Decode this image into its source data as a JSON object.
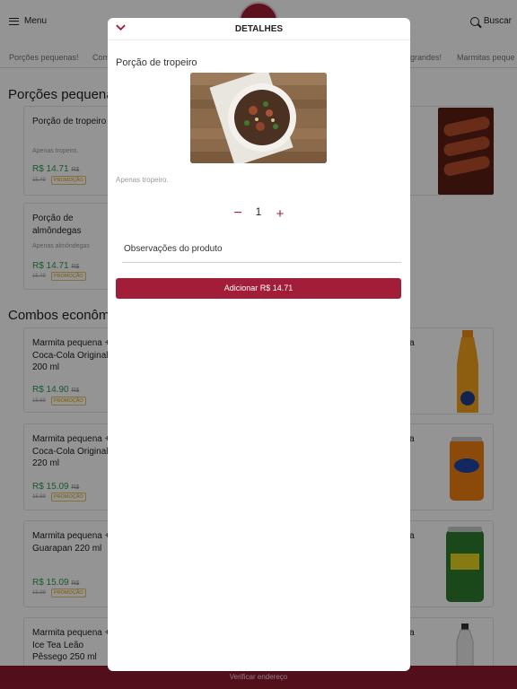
{
  "header": {
    "menu_label": "Menu",
    "search_label": "Buscar",
    "icons": [
      "menu-icon",
      "search-icon",
      "logo"
    ]
  },
  "categories": [
    "Porções pequenas!",
    "Com",
    "grandes!",
    "Marmitas peque"
  ],
  "sections": {
    "small_portions": "Porções pequenas",
    "combos": "Combos econômic"
  },
  "products": [
    {
      "name": "Porção de tropeiro",
      "desc": "Apenas tropeiro.",
      "price": "R$ 14.71",
      "price_prefix": "R$",
      "old": "15.49",
      "badge": "PROMOÇÃO"
    },
    {
      "name": "Porção de almôndegas",
      "desc": "Apenas almôndegas",
      "price": "R$ 14.71",
      "price_prefix": "R$",
      "old": "15.49",
      "badge": "PROMOÇÃO"
    },
    {
      "name": "Marmita pequena + Coca-Cola Original 200 ml",
      "price": "R$ 14.90",
      "price_prefix": "R$",
      "old": "15.69",
      "badge": "PROMOÇÃO"
    },
    {
      "name": "Marmita pequena + Coca-Cola Original 220 ml",
      "price": "R$ 15.09",
      "price_prefix": "R$",
      "old": "15.89",
      "badge": "PROMOÇÃO"
    },
    {
      "name": "Marmita pequena + Guarapan 220 ml",
      "price": "R$ 15.09",
      "price_prefix": "R$",
      "old": "15.89",
      "badge": "PROMOÇÃO"
    },
    {
      "name": "Marmita pequena + Ice Tea Leão Pêssego 250 ml"
    }
  ],
  "right_cards": [
    {
      "lines": [
        "ena",
        "a"
      ]
    },
    {
      "lines": [
        "ena",
        "a"
      ]
    },
    {
      "lines": [
        "ena"
      ]
    },
    {
      "lines": [
        "ena",
        "le",
        "50"
      ]
    }
  ],
  "bottom_bar": {
    "label": "Verificar endereço"
  },
  "modal": {
    "title": "DETALHES",
    "product_name": "Porção de tropeiro",
    "description": "Apenas tropeiro.",
    "quantity": "1",
    "minus": "−",
    "plus": "+",
    "observations_label": "Observações do produto",
    "add_button": "Adicionar R$ 14.71"
  },
  "colors": {
    "brand": "#a11d38",
    "price_green": "#2e9a57",
    "promo": "#d4a000"
  }
}
